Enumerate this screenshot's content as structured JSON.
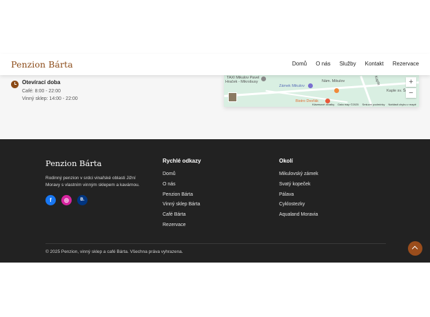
{
  "header": {
    "brand": "Penzion Bárta",
    "nav": [
      "Domů",
      "O nás",
      "Služby",
      "Kontakt",
      "Rezervace"
    ]
  },
  "contact": {
    "hours_title": "Otevírací doba",
    "hours_lines": [
      "Café: 8:00 - 22:00",
      "Vinný sklep: 14:00 - 22:00"
    ]
  },
  "map": {
    "labels": [
      "TAXI Mikulov Pavel",
      "Hraček - Mikrobusy",
      "Zámek Mikulov",
      "Nám. Mikulov",
      "Kaple sv. Šebe",
      "Bistro Dvořák",
      "Kaple"
    ],
    "attribution": [
      "Klávesové zkratky",
      "Data map ©2025",
      "Smluvní podmínky",
      "Nahlásit chybu v mapě"
    ],
    "zoom_in": "+",
    "zoom_out": "−"
  },
  "footer": {
    "brand": "Penzion Bárta",
    "description": "Rodinný penzion v srdci vinařské oblasti Jižní Moravy s vlastním vinným sklepem a kavárnou.",
    "social": [
      {
        "icon": "facebook-icon",
        "glyph": "f",
        "color": "#1877f2"
      },
      {
        "icon": "instagram-icon",
        "glyph": "◎",
        "color": "#d6249f"
      },
      {
        "icon": "booking-icon",
        "glyph": "B.",
        "color": "#003580"
      }
    ],
    "quick_links_title": "Rychlé odkazy",
    "quick_links": [
      "Domů",
      "O nás",
      "Penzion Bárta",
      "Vinný sklep Bárta",
      "Café Bárta",
      "Rezervace"
    ],
    "surroundings_title": "Okolí",
    "surroundings": [
      "Mikulovský zámek",
      "Svatý kopeček",
      "Pálava",
      "Cyklostezky",
      "Aqualand Moravia"
    ],
    "copyright": "© 2025 Penzion, vinný sklep a café Bárta. Všechna práva vyhrazena."
  },
  "colors": {
    "brand": "#8b4a17",
    "footer_bg": "#222222",
    "accent_button": "#9a4d1c"
  }
}
